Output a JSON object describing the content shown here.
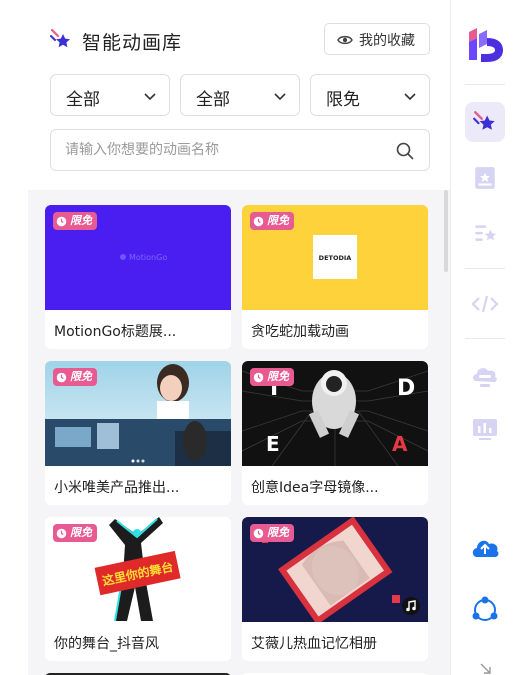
{
  "header": {
    "title": "智能动画库",
    "favorites_label": "我的收藏"
  },
  "filters": [
    {
      "value": "全部"
    },
    {
      "value": "全部"
    },
    {
      "value": "限免"
    }
  ],
  "search": {
    "placeholder": "请输入你想要的动画名称"
  },
  "badge_text": "限免",
  "cards": [
    {
      "name": "MotionGo标题展...",
      "thumb_text": "MotionGo"
    },
    {
      "name": "贪吃蛇加载动画",
      "thumb_text": "DETODIA"
    },
    {
      "name": "小米唯美产品推出..."
    },
    {
      "name": "创意Idea字母镜像...",
      "letters": [
        "I",
        "D",
        "E",
        "A"
      ]
    },
    {
      "name": "你的舞台_抖音风",
      "thumb_text": "这里你的舞台"
    },
    {
      "name": "艾薇儿热血记忆相册"
    }
  ],
  "sidebar": {
    "items": [
      "star-library",
      "template",
      "favorites",
      "code",
      "text-icon",
      "chart",
      "upload",
      "share"
    ]
  },
  "colors": {
    "accent": "#3b2fd6",
    "badge": "#e85a92",
    "sidebar_icon_light": "#d6d3f3"
  }
}
